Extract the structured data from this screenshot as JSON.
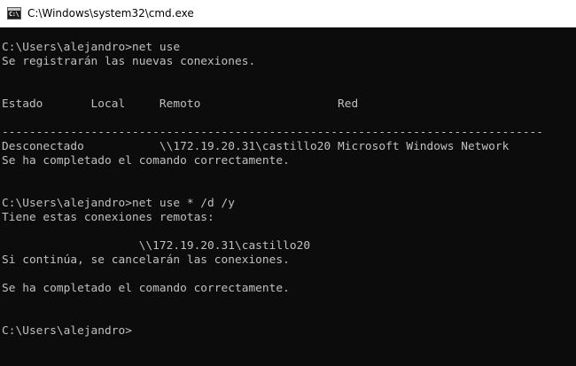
{
  "window": {
    "title": "C:\\Windows\\system32\\cmd.exe",
    "icon": "cmd-icon",
    "icon_glyph": "C:\\"
  },
  "console": {
    "lines": [
      "C:\\Users\\alejandro>net use",
      "Se registrarán las nuevas conexiones.",
      "Estado       Local     Remoto                    Red",
      "-------------------------------------------------------------------------------",
      "Desconectado           \\\\172.19.20.31\\castillo20 Microsoft Windows Network",
      "Se ha completado el comando correctamente.",
      "C:\\Users\\alejandro>net use * /d /y",
      "Tiene estas conexiones remotas:",
      "                    \\\\172.19.20.31\\castillo20",
      "Si continúa, se cancelarán las conexiones.",
      "Se ha completado el comando correctamente.",
      "C:\\Users\\alejandro>"
    ]
  },
  "colors": {
    "console_background": "#0c0c0c",
    "console_text": "#c0c0c0",
    "titlebar_background": "#ffffff"
  }
}
